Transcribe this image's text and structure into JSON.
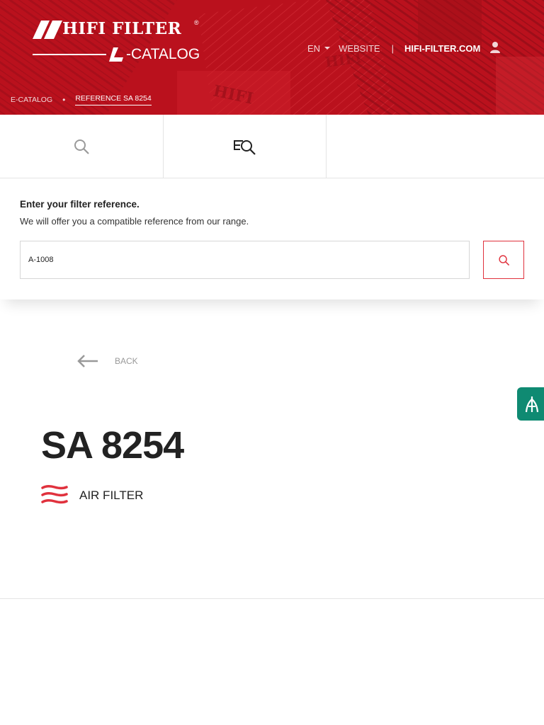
{
  "header": {
    "brand_name": "HIFI FILTER",
    "brand_registered": "®",
    "brand_subtitle": "-CATALOG",
    "language": "EN",
    "website_label": "WEBSITE",
    "separator": "|",
    "main_site_link": "HIFI-FILTER.COM",
    "account_icon": "user-icon",
    "accent_color": "#c4121f"
  },
  "breadcrumb": {
    "items": [
      "E-CATALOG",
      "REFERENCE SA 8254"
    ],
    "separator": "•"
  },
  "tabs": [
    {
      "name": "search-tab",
      "icon": "search-icon"
    },
    {
      "name": "equivalence-search-tab",
      "icon": "equivalence-search-icon"
    },
    {
      "name": "empty-tab",
      "icon": ""
    }
  ],
  "search_panel": {
    "title": "Enter your filter reference.",
    "subtitle": "We will offer you a compatible reference from our range.",
    "input_value": "A-1008",
    "button_icon": "search-icon",
    "button_color": "#e0313d"
  },
  "content": {
    "back_label": "BACK",
    "product_reference": "SA 8254",
    "product_type": "AIR FILTER",
    "product_type_icon": "air-waves-icon",
    "side_tab_icon": "filter-icon",
    "side_tab_color": "#0f8a72"
  }
}
